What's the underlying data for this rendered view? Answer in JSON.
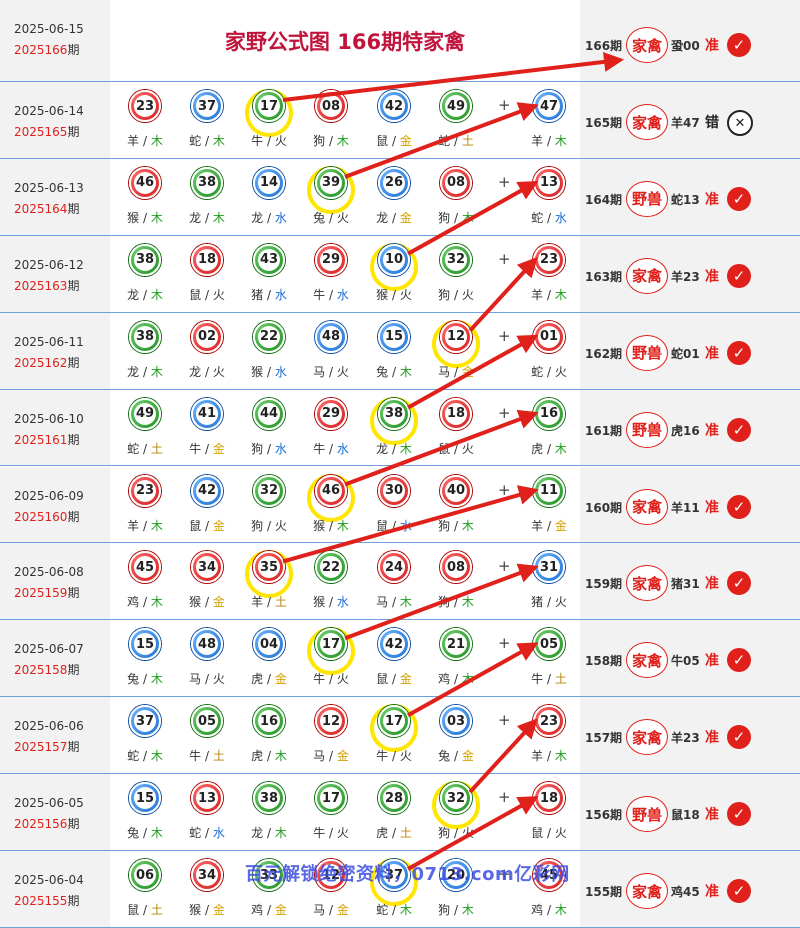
{
  "header": {
    "date": "2025-06-15",
    "issue_num": "2025166",
    "issue_suffix": "期",
    "title": "家野公式图 166期特家禽",
    "result": {
      "issue": "166期",
      "stamp": "家禽",
      "pick": "蛩00",
      "verdict": "准",
      "status": "check"
    }
  },
  "colors": {
    "red": "#e0201b",
    "highlight": "#ffe600",
    "title": "#c0143c",
    "row_border": "#6fa0dc"
  },
  "plus_sign": "+",
  "rows": [
    {
      "date": "2025-06-14",
      "issue_num": "2025165",
      "issue_suffix": "期",
      "highlight_index": 2,
      "balls": [
        {
          "num": "23",
          "color": "red",
          "zodiac": "羊",
          "element": "木"
        },
        {
          "num": "37",
          "color": "blue",
          "zodiac": "蛇",
          "element": "木"
        },
        {
          "num": "17",
          "color": "green",
          "zodiac": "牛",
          "element": "火"
        },
        {
          "num": "08",
          "color": "red",
          "zodiac": "狗",
          "element": "木"
        },
        {
          "num": "42",
          "color": "blue",
          "zodiac": "鼠",
          "element": "金"
        },
        {
          "num": "49",
          "color": "green",
          "zodiac": "蛇",
          "element": "土"
        },
        {
          "num": "47",
          "color": "blue",
          "zodiac": "羊",
          "element": "木"
        }
      ],
      "result": {
        "issue": "165期",
        "stamp": "家禽",
        "pick": "羊47",
        "verdict": "错",
        "status": "cross"
      }
    },
    {
      "date": "2025-06-13",
      "issue_num": "2025164",
      "issue_suffix": "期",
      "highlight_index": 3,
      "balls": [
        {
          "num": "46",
          "color": "red",
          "zodiac": "猴",
          "element": "木"
        },
        {
          "num": "38",
          "color": "green",
          "zodiac": "龙",
          "element": "木"
        },
        {
          "num": "14",
          "color": "blue",
          "zodiac": "龙",
          "element": "水"
        },
        {
          "num": "39",
          "color": "green",
          "zodiac": "兔",
          "element": "火"
        },
        {
          "num": "26",
          "color": "blue",
          "zodiac": "龙",
          "element": "金"
        },
        {
          "num": "08",
          "color": "red",
          "zodiac": "狗",
          "element": "木"
        },
        {
          "num": "13",
          "color": "red",
          "zodiac": "蛇",
          "element": "水"
        }
      ],
      "result": {
        "issue": "164期",
        "stamp": "野兽",
        "pick": "蛇13",
        "verdict": "准",
        "status": "check"
      }
    },
    {
      "date": "2025-06-12",
      "issue_num": "2025163",
      "issue_suffix": "期",
      "highlight_index": 4,
      "balls": [
        {
          "num": "38",
          "color": "green",
          "zodiac": "龙",
          "element": "木"
        },
        {
          "num": "18",
          "color": "red",
          "zodiac": "鼠",
          "element": "火"
        },
        {
          "num": "43",
          "color": "green",
          "zodiac": "猪",
          "element": "水"
        },
        {
          "num": "29",
          "color": "red",
          "zodiac": "牛",
          "element": "水"
        },
        {
          "num": "10",
          "color": "blue",
          "zodiac": "猴",
          "element": "火"
        },
        {
          "num": "32",
          "color": "green",
          "zodiac": "狗",
          "element": "火"
        },
        {
          "num": "23",
          "color": "red",
          "zodiac": "羊",
          "element": "木"
        }
      ],
      "result": {
        "issue": "163期",
        "stamp": "家禽",
        "pick": "羊23",
        "verdict": "准",
        "status": "check"
      }
    },
    {
      "date": "2025-06-11",
      "issue_num": "2025162",
      "issue_suffix": "期",
      "highlight_index": 5,
      "balls": [
        {
          "num": "38",
          "color": "green",
          "zodiac": "龙",
          "element": "木"
        },
        {
          "num": "02",
          "color": "red",
          "zodiac": "龙",
          "element": "火"
        },
        {
          "num": "22",
          "color": "green",
          "zodiac": "猴",
          "element": "水"
        },
        {
          "num": "48",
          "color": "blue",
          "zodiac": "马",
          "element": "火"
        },
        {
          "num": "15",
          "color": "blue",
          "zodiac": "兔",
          "element": "木"
        },
        {
          "num": "12",
          "color": "red",
          "zodiac": "马",
          "element": "金"
        },
        {
          "num": "01",
          "color": "red",
          "zodiac": "蛇",
          "element": "火"
        }
      ],
      "result": {
        "issue": "162期",
        "stamp": "野兽",
        "pick": "蛇01",
        "verdict": "准",
        "status": "check"
      }
    },
    {
      "date": "2025-06-10",
      "issue_num": "2025161",
      "issue_suffix": "期",
      "highlight_index": 4,
      "balls": [
        {
          "num": "49",
          "color": "green",
          "zodiac": "蛇",
          "element": "土"
        },
        {
          "num": "41",
          "color": "blue",
          "zodiac": "牛",
          "element": "金"
        },
        {
          "num": "44",
          "color": "green",
          "zodiac": "狗",
          "element": "水"
        },
        {
          "num": "29",
          "color": "red",
          "zodiac": "牛",
          "element": "水"
        },
        {
          "num": "38",
          "color": "green",
          "zodiac": "龙",
          "element": "木"
        },
        {
          "num": "18",
          "color": "red",
          "zodiac": "鼠",
          "element": "火"
        },
        {
          "num": "16",
          "color": "green",
          "zodiac": "虎",
          "element": "木"
        }
      ],
      "result": {
        "issue": "161期",
        "stamp": "野兽",
        "pick": "虎16",
        "verdict": "准",
        "status": "check"
      }
    },
    {
      "date": "2025-06-09",
      "issue_num": "2025160",
      "issue_suffix": "期",
      "highlight_index": 3,
      "balls": [
        {
          "num": "23",
          "color": "red",
          "zodiac": "羊",
          "element": "木"
        },
        {
          "num": "42",
          "color": "blue",
          "zodiac": "鼠",
          "element": "金"
        },
        {
          "num": "32",
          "color": "green",
          "zodiac": "狗",
          "element": "火"
        },
        {
          "num": "46",
          "color": "red",
          "zodiac": "猴",
          "element": "木"
        },
        {
          "num": "30",
          "color": "red",
          "zodiac": "鼠",
          "element": "水"
        },
        {
          "num": "40",
          "color": "red",
          "zodiac": "狗",
          "element": "木"
        },
        {
          "num": "11",
          "color": "green",
          "zodiac": "羊",
          "element": "金"
        }
      ],
      "result": {
        "issue": "160期",
        "stamp": "家禽",
        "pick": "羊11",
        "verdict": "准",
        "status": "check"
      }
    },
    {
      "date": "2025-06-08",
      "issue_num": "2025159",
      "issue_suffix": "期",
      "highlight_index": 2,
      "balls": [
        {
          "num": "45",
          "color": "red",
          "zodiac": "鸡",
          "element": "木"
        },
        {
          "num": "34",
          "color": "red",
          "zodiac": "猴",
          "element": "金"
        },
        {
          "num": "35",
          "color": "red",
          "zodiac": "羊",
          "element": "土"
        },
        {
          "num": "22",
          "color": "green",
          "zodiac": "猴",
          "element": "水"
        },
        {
          "num": "24",
          "color": "red",
          "zodiac": "马",
          "element": "木"
        },
        {
          "num": "08",
          "color": "red",
          "zodiac": "狗",
          "element": "木"
        },
        {
          "num": "31",
          "color": "blue",
          "zodiac": "猪",
          "element": "火"
        }
      ],
      "result": {
        "issue": "159期",
        "stamp": "家禽",
        "pick": "猪31",
        "verdict": "准",
        "status": "check"
      }
    },
    {
      "date": "2025-06-07",
      "issue_num": "2025158",
      "issue_suffix": "期",
      "highlight_index": 3,
      "balls": [
        {
          "num": "15",
          "color": "blue",
          "zodiac": "兔",
          "element": "木"
        },
        {
          "num": "48",
          "color": "blue",
          "zodiac": "马",
          "element": "火"
        },
        {
          "num": "04",
          "color": "blue",
          "zodiac": "虎",
          "element": "金"
        },
        {
          "num": "17",
          "color": "green",
          "zodiac": "牛",
          "element": "火"
        },
        {
          "num": "42",
          "color": "blue",
          "zodiac": "鼠",
          "element": "金"
        },
        {
          "num": "21",
          "color": "green",
          "zodiac": "鸡",
          "element": "木"
        },
        {
          "num": "05",
          "color": "green",
          "zodiac": "牛",
          "element": "土"
        }
      ],
      "result": {
        "issue": "158期",
        "stamp": "家禽",
        "pick": "牛05",
        "verdict": "准",
        "status": "check"
      }
    },
    {
      "date": "2025-06-06",
      "issue_num": "2025157",
      "issue_suffix": "期",
      "highlight_index": 4,
      "balls": [
        {
          "num": "37",
          "color": "blue",
          "zodiac": "蛇",
          "element": "木"
        },
        {
          "num": "05",
          "color": "green",
          "zodiac": "牛",
          "element": "土"
        },
        {
          "num": "16",
          "color": "green",
          "zodiac": "虎",
          "element": "木"
        },
        {
          "num": "12",
          "color": "red",
          "zodiac": "马",
          "element": "金"
        },
        {
          "num": "17",
          "color": "green",
          "zodiac": "牛",
          "element": "火"
        },
        {
          "num": "03",
          "color": "blue",
          "zodiac": "兔",
          "element": "金"
        },
        {
          "num": "23",
          "color": "red",
          "zodiac": "羊",
          "element": "木"
        }
      ],
      "result": {
        "issue": "157期",
        "stamp": "家禽",
        "pick": "羊23",
        "verdict": "准",
        "status": "check"
      }
    },
    {
      "date": "2025-06-05",
      "issue_num": "2025156",
      "issue_suffix": "期",
      "highlight_index": 5,
      "balls": [
        {
          "num": "15",
          "color": "blue",
          "zodiac": "兔",
          "element": "木"
        },
        {
          "num": "13",
          "color": "red",
          "zodiac": "蛇",
          "element": "水"
        },
        {
          "num": "38",
          "color": "green",
          "zodiac": "龙",
          "element": "木"
        },
        {
          "num": "17",
          "color": "green",
          "zodiac": "牛",
          "element": "火"
        },
        {
          "num": "28",
          "color": "green",
          "zodiac": "虎",
          "element": "土"
        },
        {
          "num": "32",
          "color": "green",
          "zodiac": "狗",
          "element": "火"
        },
        {
          "num": "18",
          "color": "red",
          "zodiac": "鼠",
          "element": "火"
        }
      ],
      "result": {
        "issue": "156期",
        "stamp": "野兽",
        "pick": "鼠18",
        "verdict": "准",
        "status": "check"
      }
    },
    {
      "date": "2025-06-04",
      "issue_num": "2025155",
      "issue_suffix": "期",
      "highlight_index": 4,
      "balls": [
        {
          "num": "06",
          "color": "green",
          "zodiac": "鼠",
          "element": "土"
        },
        {
          "num": "34",
          "color": "red",
          "zodiac": "猴",
          "element": "金"
        },
        {
          "num": "33",
          "color": "green",
          "zodiac": "鸡",
          "element": "金"
        },
        {
          "num": "12",
          "color": "red",
          "zodiac": "马",
          "element": "金"
        },
        {
          "num": "37",
          "color": "blue",
          "zodiac": "蛇",
          "element": "木"
        },
        {
          "num": "20",
          "color": "blue",
          "zodiac": "狗",
          "element": "木"
        },
        {
          "num": "45",
          "color": "red",
          "zodiac": "鸡",
          "element": "木"
        }
      ],
      "result": {
        "issue": "155期",
        "stamp": "家禽",
        "pick": "鸡45",
        "verdict": "准",
        "status": "check"
      }
    }
  ],
  "watermark": "百元解锁绝密资料，0713.com亿彩网"
}
